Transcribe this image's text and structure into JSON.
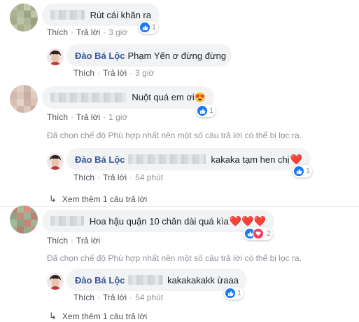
{
  "comments": [
    {
      "text": "Rút cái khăn ra",
      "like_label": "Thích",
      "reply_label": "Trả lời",
      "time": "3 giờ",
      "reaction_count": "1"
    },
    {
      "text": "Nuột quá em ơi😍",
      "like_label": "Thích",
      "reply_label": "Trả lời",
      "time": "1 giờ",
      "reaction_count": "1",
      "filter_note": "Đã chọn chế độ Phù hợp nhất nên một số câu trả lời có thể bị lọc ra.",
      "more_replies": "Xem thêm 1 câu trả lời"
    },
    {
      "text": "Hoa hậu quận 10 chân dài quá kìa",
      "hearts": "❤️❤️❤️",
      "like_label": "Thích",
      "reply_label": "Trả lời",
      "reaction_count": "2",
      "filter_note": "Đã chọn chế độ Phù hợp nhất nên một số câu trả lời có thể bị lọc ra.",
      "more_replies": "Xem thêm 1 câu trả lời"
    }
  ],
  "replies": [
    {
      "author": "Đào Bá Lộc",
      "text": "Phạm Yến ơ đừng đừng",
      "like_label": "Thích",
      "reply_label": "Trả lời",
      "time": "3 giờ"
    },
    {
      "author": "Đào Bá Lộc",
      "text": "kakaka tạm hen chị",
      "heart": "❤️",
      "like_label": "Thích",
      "reply_label": "Trả lời",
      "time": "54 phút",
      "reaction_count": "1"
    },
    {
      "author": "Đào Bá Lộc",
      "text": "kakakakakk ừaaa",
      "like_label": "Thích",
      "reply_label": "Trả lời",
      "time": "54 phút",
      "reaction_count": "1"
    }
  ],
  "colors": {
    "link_blue": "#385898",
    "like_blue": "#1877f2",
    "heart_red": "#f33e58",
    "bubble_gray": "#f2f3f5",
    "meta_gray": "#90949c"
  },
  "icons": [
    "like-icon",
    "heart-icon",
    "reply-arrow-icon"
  ]
}
